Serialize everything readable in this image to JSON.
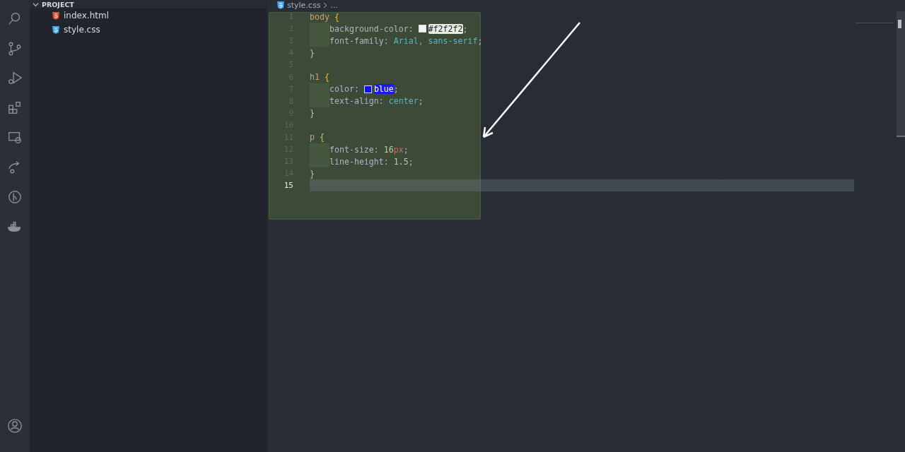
{
  "explorer": {
    "title": "PROJECT",
    "expanded": true,
    "files": [
      {
        "name": "index.html",
        "kind": "html"
      },
      {
        "name": "style.css",
        "kind": "css"
      }
    ]
  },
  "breadcrumb": {
    "file": "style.css",
    "rest": "..."
  },
  "editor": {
    "lines": [
      {
        "number": "1",
        "current": false,
        "indented": false,
        "tokens": [
          {
            "kind": "selector",
            "text": "body"
          },
          {
            "kind": "brace",
            "text": " {"
          }
        ]
      },
      {
        "number": "2",
        "current": false,
        "indented": true,
        "tokens": [
          {
            "kind": "property",
            "text": "background-color"
          },
          {
            "kind": "plain",
            "text": ": "
          },
          {
            "kind": "swatch",
            "color": "#f2f2f2"
          },
          {
            "kind": "highlight",
            "text": "#f2f2f2",
            "color": "#e8ece0"
          },
          {
            "kind": "plain",
            "text": ";"
          }
        ]
      },
      {
        "number": "3",
        "current": false,
        "indented": true,
        "tokens": [
          {
            "kind": "property",
            "text": "font-family"
          },
          {
            "kind": "plain",
            "text": ": "
          },
          {
            "kind": "value",
            "text": "Arial, sans-serif"
          },
          {
            "kind": "plain",
            "text": ";"
          }
        ]
      },
      {
        "number": "4",
        "current": false,
        "indented": false,
        "tokens": [
          {
            "kind": "brace",
            "text": "}"
          }
        ]
      },
      {
        "number": "5",
        "current": false,
        "indented": false
      },
      {
        "number": "6",
        "current": false,
        "indented": false,
        "tokens": [
          {
            "kind": "selector",
            "text": "h1"
          },
          {
            "kind": "brace",
            "text": " {"
          }
        ]
      },
      {
        "number": "7",
        "current": false,
        "indented": true,
        "tokens": [
          {
            "kind": "property",
            "text": "color"
          },
          {
            "kind": "plain",
            "text": ": "
          },
          {
            "kind": "swatch",
            "color": "#1010e0"
          },
          {
            "kind": "highlight",
            "text": "blue",
            "color": "#1a1ae6"
          },
          {
            "kind": "plain",
            "text": ";"
          }
        ]
      },
      {
        "number": "8",
        "current": false,
        "indented": true,
        "tokens": [
          {
            "kind": "property",
            "text": "text-align"
          },
          {
            "kind": "plain",
            "text": ": "
          },
          {
            "kind": "value",
            "text": "center"
          },
          {
            "kind": "plain",
            "text": ";"
          }
        ]
      },
      {
        "number": "9",
        "current": false,
        "indented": false,
        "tokens": [
          {
            "kind": "brace",
            "text": "}"
          }
        ]
      },
      {
        "number": "10",
        "current": false,
        "indented": false
      },
      {
        "number": "11",
        "current": false,
        "indented": false,
        "tokens": [
          {
            "kind": "selector",
            "text": "p"
          },
          {
            "kind": "brace",
            "text": " {"
          }
        ]
      },
      {
        "number": "12",
        "current": false,
        "indented": true,
        "tokens": [
          {
            "kind": "property",
            "text": "font-size"
          },
          {
            "kind": "plain",
            "text": ": "
          },
          {
            "kind": "number",
            "text": "16"
          },
          {
            "kind": "unit",
            "text": "px"
          },
          {
            "kind": "plain",
            "text": ";"
          }
        ]
      },
      {
        "number": "13",
        "current": false,
        "indented": true,
        "tokens": [
          {
            "kind": "property",
            "text": "line-height"
          },
          {
            "kind": "plain",
            "text": ": "
          },
          {
            "kind": "number",
            "text": "1.5"
          },
          {
            "kind": "plain",
            "text": ";"
          }
        ]
      },
      {
        "number": "14",
        "current": false,
        "indented": false,
        "tokens": [
          {
            "kind": "brace",
            "text": "}"
          }
        ]
      },
      {
        "number": "15",
        "current": true,
        "indented": false
      }
    ]
  }
}
